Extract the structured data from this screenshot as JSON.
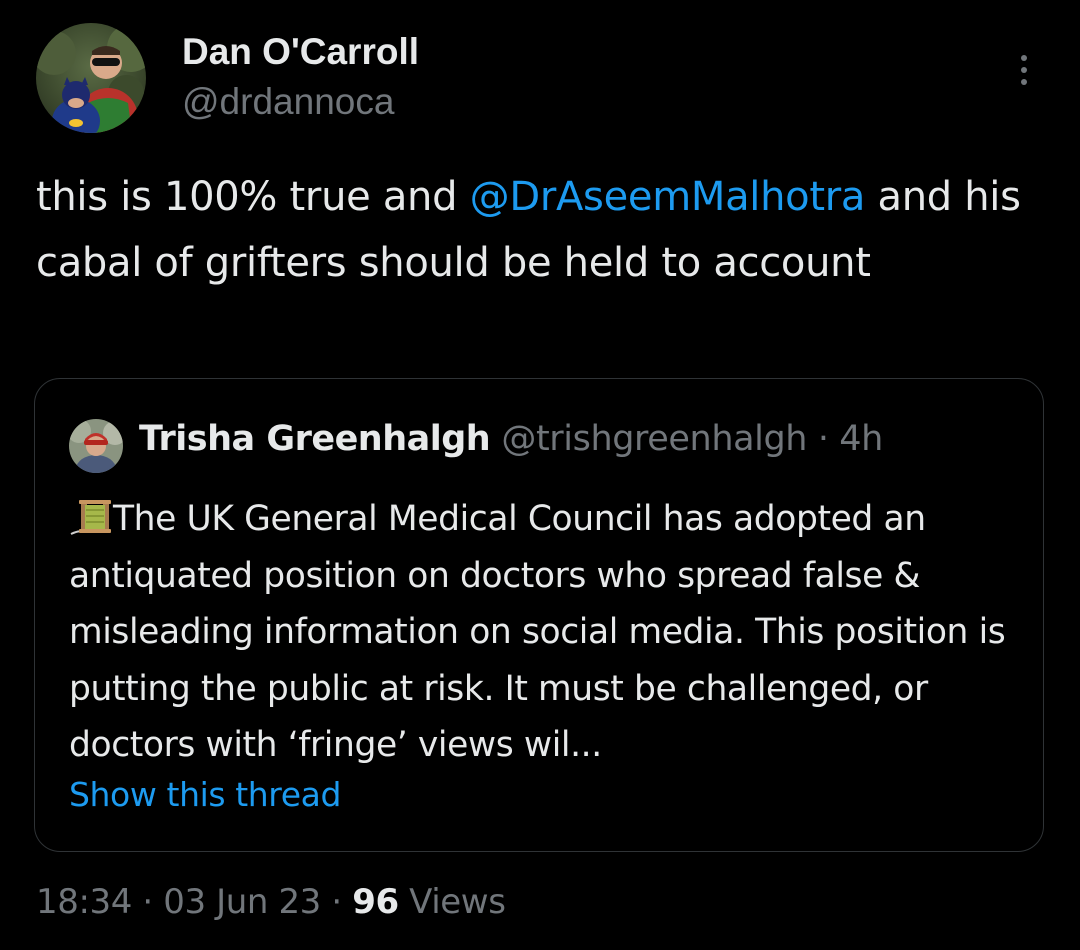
{
  "tweet": {
    "author": {
      "name": "Dan O'Carroll",
      "handle": "@drdannoca",
      "avatar_icon": "profile-photo-icon"
    },
    "text_parts": {
      "before": "this is 100% true and ",
      "mention": "@DrAseemMalhotra",
      "after": " and his cabal of grifters should be held to account"
    },
    "more_icon": "more-options-icon",
    "quote": {
      "name": "Trisha Greenhalgh",
      "handle": "@trishgreenhalgh",
      "separator": "·",
      "time": "4h",
      "icon": "thread-spool-icon",
      "text": "The UK General Medical Council has adopted an antiquated position on doctors who spread false & misleading information on social media. This position is putting the public at risk. It must be challenged, or doctors with ‘fringe’ views wil...",
      "show_thread": "Show this thread"
    },
    "footer": {
      "time": "18:34",
      "separator": "·",
      "date": "03 Jun 23",
      "views_count": "96",
      "views_label": "Views"
    }
  },
  "colors": {
    "background": "#000000",
    "text": "#e7e9ea",
    "secondary_text": "#71767b",
    "link": "#1d9bf0",
    "border": "#2f3336"
  }
}
